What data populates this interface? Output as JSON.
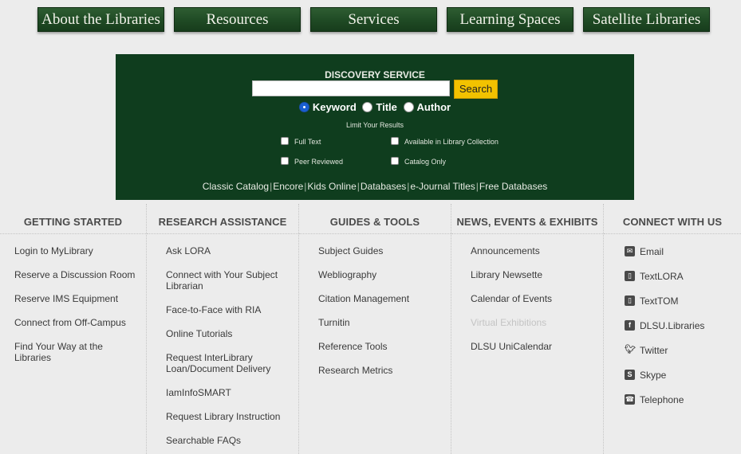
{
  "nav": {
    "items": [
      "About the Libraries",
      "Resources",
      "Services",
      "Learning Spaces",
      "Satellite Libraries"
    ]
  },
  "discovery": {
    "title": "DISCOVERY SERVICE",
    "search_value": "",
    "search_button": "Search",
    "radios": [
      {
        "label": "Keyword",
        "selected": true
      },
      {
        "label": "Title",
        "selected": false
      },
      {
        "label": "Author",
        "selected": false
      }
    ],
    "limit_label": "Limit Your Results",
    "checkboxes": [
      "Full Text",
      "Available in Library Collection",
      "Peer Reviewed",
      "Catalog Only"
    ],
    "quicklinks": [
      "Classic Catalog",
      "Encore",
      "Kids Online",
      "Databases",
      "e-Journal Titles",
      "Free Databases"
    ]
  },
  "footer": {
    "getting_started": {
      "heading": "GETTING STARTED",
      "links": [
        "Login to MyLibrary",
        "Reserve a Discussion Room",
        "Reserve IMS Equipment",
        "Connect from Off-Campus",
        "Find Your Way at the Libraries"
      ]
    },
    "research_assistance": {
      "heading": "RESEARCH ASSISTANCE",
      "links": [
        "Ask LORA",
        "Connect with Your Subject Librarian",
        "Face-to-Face with RIA",
        "Online Tutorials",
        "Request InterLibrary Loan/Document Delivery",
        "IamInfoSMART",
        "Request Library Instruction",
        "Searchable FAQs"
      ]
    },
    "guides_tools": {
      "heading": "GUIDES & TOOLS",
      "links": [
        "Subject Guides",
        "Webliography",
        "Citation Management",
        "Turnitin",
        "Reference Tools",
        "Research Metrics"
      ]
    },
    "news_events": {
      "heading": "NEWS, EVENTS & EXHIBITS",
      "links": [
        "Announcements",
        "Library Newsette",
        "Calendar of Events",
        "Virtual Exhibitions",
        "DLSU UniCalendar"
      ]
    },
    "connect": {
      "heading": "CONNECT WITH US",
      "links": [
        {
          "label": "Email",
          "icon": "email-icon"
        },
        {
          "label": "TextLORA",
          "icon": "mobile-icon"
        },
        {
          "label": "TextTOM",
          "icon": "mobile-icon"
        },
        {
          "label": "DLSU.Libraries",
          "icon": "facebook-icon"
        },
        {
          "label": "Twitter",
          "icon": "twitter-icon"
        },
        {
          "label": "Skype",
          "icon": "skype-icon"
        },
        {
          "label": "Telephone",
          "icon": "telephone-icon"
        }
      ]
    }
  },
  "colors": {
    "nav_green": "#1f4a24",
    "discovery_bg": "#0f3d1e",
    "search_button": "#f2c200",
    "page_bg": "#ececec",
    "muted_link": "#c4c4c4"
  }
}
